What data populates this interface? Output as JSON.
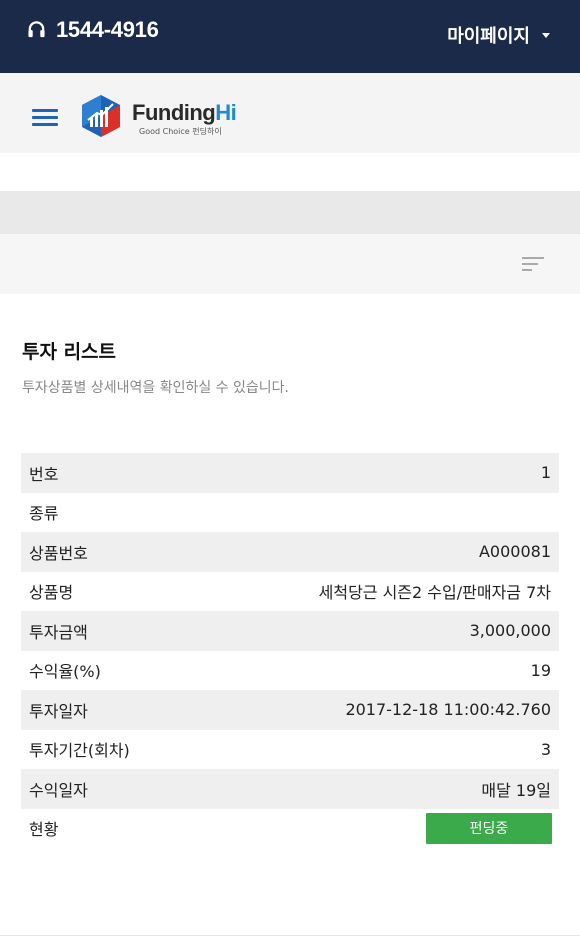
{
  "topbar": {
    "phone": "1544-4916",
    "mypage_label": "마이페이지"
  },
  "header": {
    "brand_main": "Funding",
    "brand_accent": "Hi",
    "tagline": "Good Choice 펀딩하이"
  },
  "content": {
    "title": "투자 리스트",
    "subtitle": "투자상품별 상세내역을 확인하실 수 있습니다."
  },
  "investment": {
    "rows": [
      {
        "label": "번호",
        "value": "1"
      },
      {
        "label": "종류",
        "value": ""
      },
      {
        "label": "상품번호",
        "value": "A000081"
      },
      {
        "label": "상품명",
        "value": "세척당근 시즌2 수입/판매자금 7차"
      },
      {
        "label": "투자금액",
        "value": "3,000,000"
      },
      {
        "label": "수익율(%)",
        "value": "19"
      },
      {
        "label": "투자일자",
        "value": "2017-12-18 11:00:42.760"
      },
      {
        "label": "투자기간(회차)",
        "value": "3"
      },
      {
        "label": "수익일자",
        "value": "매달 19일"
      }
    ],
    "status_label": "현황",
    "status_value": "펀딩중"
  },
  "colors": {
    "topbar": "#1c2a4a",
    "accent_blue": "#1e63b8",
    "status_green": "#3aaa4a"
  },
  "icons": {
    "phone": "headset-icon",
    "menu": "hamburger-menu-icon",
    "filter": "filter-lines-icon",
    "dropdown": "caret-down-icon"
  }
}
